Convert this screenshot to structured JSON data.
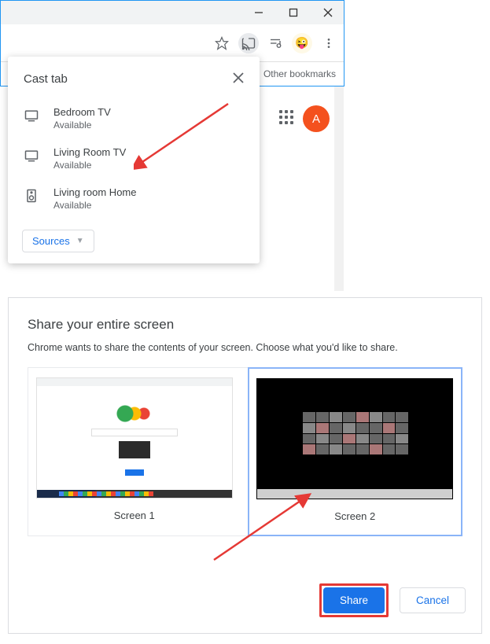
{
  "browser": {
    "bookmarks_folder": "Other bookmarks",
    "profile_letter": "A"
  },
  "cast_popup": {
    "title": "Cast tab",
    "devices": [
      {
        "name": "Bedroom TV",
        "status": "Available",
        "type": "tv"
      },
      {
        "name": "Living Room TV",
        "status": "Available",
        "type": "tv"
      },
      {
        "name": "Living room Home",
        "status": "Available",
        "type": "speaker"
      }
    ],
    "sources_label": "Sources"
  },
  "share_dialog": {
    "title": "Share your entire screen",
    "subtitle": "Chrome wants to share the contents of your screen. Choose what you'd like to share.",
    "screens": [
      {
        "label": "Screen 1",
        "selected": false
      },
      {
        "label": "Screen 2",
        "selected": true
      }
    ],
    "share_button": "Share",
    "cancel_button": "Cancel"
  }
}
